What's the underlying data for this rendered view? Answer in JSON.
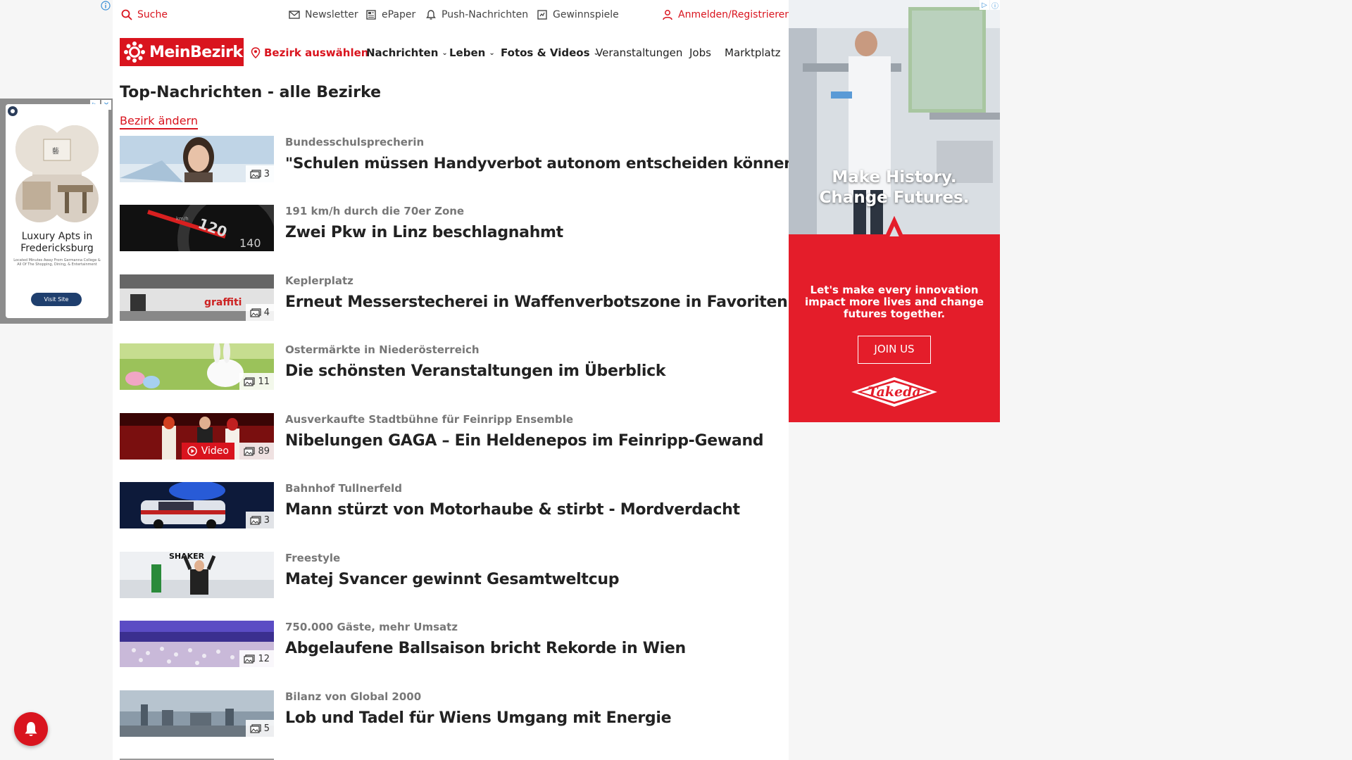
{
  "utility_bar": {
    "search": "Suche",
    "newsletter": "Newsletter",
    "epaper": "ePaper",
    "push": "Push-Nachrichten",
    "games": "Gewinnspiele",
    "login": "Anmelden/Registrieren"
  },
  "nav": {
    "logo": "MeinBezirk",
    "district_select": "Bezirk auswählen",
    "items": [
      "Nachrichten",
      "Leben",
      "Fotos & Videos",
      "Veranstaltungen",
      "Jobs",
      "Marktplatz"
    ]
  },
  "page": {
    "heading": "Top-Nachrichten - alle Bezirke",
    "change_district": "Bezirk ändern"
  },
  "articles": [
    {
      "kicker": "Bundesschulsprecherin",
      "headline": "\"Schulen müssen Handyverbot autonom entscheiden können\"",
      "photos": "3"
    },
    {
      "kicker": "191 km/h durch die 70er Zone",
      "headline": "Zwei Pkw in Linz beschlagnahmt",
      "photos": ""
    },
    {
      "kicker": "Keplerplatz",
      "headline": "Erneut Messerstecherei in Waffenverbotszone in Favoriten",
      "photos": "4"
    },
    {
      "kicker": "Ostermärkte in Niederösterreich",
      "headline": "Die schönsten Veranstaltungen im Überblick",
      "photos": "11"
    },
    {
      "kicker": "Ausverkaufte Stadtbühne für Feinripp Ensemble",
      "headline": "Nibelungen GAGA – Ein Heldenepos im Feinripp-Gewand",
      "photos": "89",
      "video": "Video"
    },
    {
      "kicker": "Bahnhof Tullnerfeld",
      "headline": "Mann stürzt von Motorhaube & stirbt - Mordverdacht",
      "photos": "3"
    },
    {
      "kicker": "Freestyle",
      "headline": "Matej Svancer gewinnt Gesamtweltcup",
      "photos": ""
    },
    {
      "kicker": "750.000 Gäste, mehr Umsatz",
      "headline": "Abgelaufene Ballsaison bricht Rekorde in Wien",
      "photos": "12"
    },
    {
      "kicker": "Bilanz von Global 2000",
      "headline": "Lob und Tadel für Wiens Umgang mit Energie",
      "photos": "5"
    }
  ],
  "left_ad": {
    "title": "Luxury Apts in Fredericksburg",
    "small_text": "Located Minutes Away From Germanna College & All Of The Shopping, Dining, & Entertainment",
    "button": "Visit Site"
  },
  "right_ad": {
    "hero_line1": "Make History.",
    "hero_line2": "Change Futures.",
    "copy": "Let's make every innovation impact more lives and change futures together.",
    "button": "JOIN US",
    "brand": "Takeda"
  },
  "colors": {
    "brand_red": "#d9141e",
    "ad_red": "#e41d2a"
  }
}
